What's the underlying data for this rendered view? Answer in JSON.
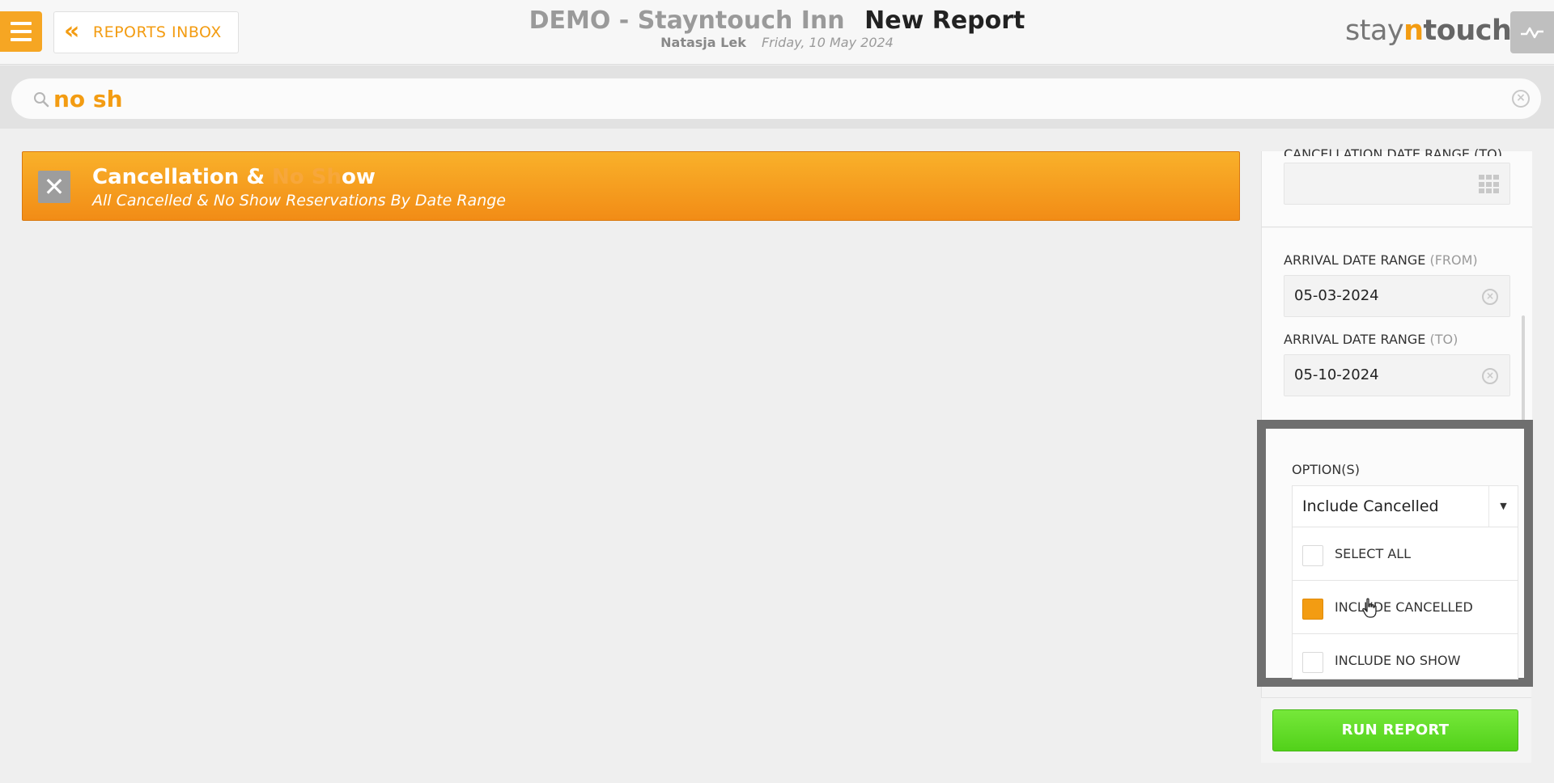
{
  "header": {
    "hotel_name": "DEMO - Stayntouch Inn",
    "page_title": "New Report",
    "user_name": "Natasja Lek",
    "date": "Friday, 10 May 2024",
    "back_label": "REPORTS INBOX",
    "logo": {
      "part1": "stay",
      "part2": "n",
      "part3": "touch"
    }
  },
  "search": {
    "value": "no sh"
  },
  "report": {
    "title_pre": "Cancellation & ",
    "title_highlight": "No Sh",
    "title_post": "ow",
    "description": "All Cancelled & No Show Reservations By Date Range"
  },
  "filters": {
    "cancellation_label": "CANCELLATION DATE RANGE (TO)",
    "cancellation_to_value": "",
    "arrival_from": {
      "label": "ARRIVAL DATE RANGE",
      "qualifier": "(FROM)",
      "value": "05-03-2024"
    },
    "arrival_to": {
      "label": "ARRIVAL DATE RANGE",
      "qualifier": "(TO)",
      "value": "05-10-2024"
    },
    "options": {
      "label": "OPTION(S)",
      "selected": "Include Cancelled",
      "items": [
        {
          "label": "SELECT ALL",
          "checked": false
        },
        {
          "label": "INCLUDE CANCELLED",
          "checked": true
        },
        {
          "label": "INCLUDE NO SHOW",
          "checked": false
        }
      ]
    }
  },
  "run_label": "RUN REPORT",
  "colors": {
    "accent": "#f39c12",
    "run": "#5cd822"
  }
}
